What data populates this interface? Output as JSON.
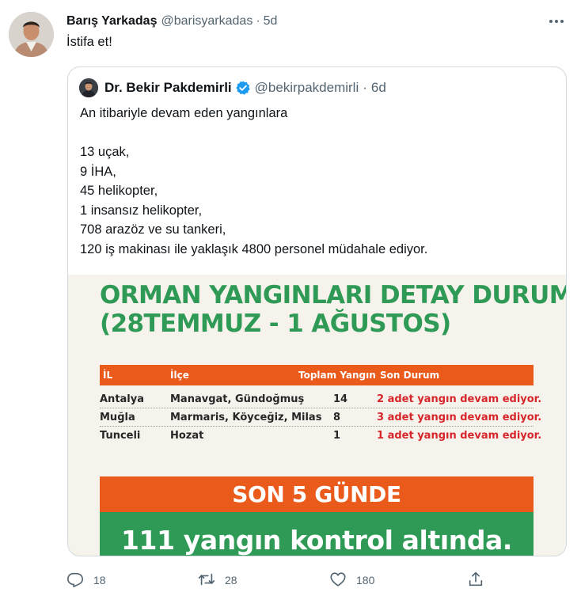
{
  "tweet": {
    "author_name": "Barış Yarkadaş",
    "author_handle": "@barisyarkadas",
    "separator": "·",
    "time": "5d",
    "text": "İstifa et!"
  },
  "quoted": {
    "author_name": "Dr. Bekir Pakdemirli",
    "author_handle": "@bekirpakdemirli",
    "separator": "·",
    "time": "6d",
    "lines": [
      "An itibariyle devam eden yangınlara",
      "",
      "13 uçak,",
      "9 İHA,",
      "45 helikopter,",
      "1 insansız helikopter,",
      "708 arazöz ve su tankeri,",
      "120 iş makinası ile yaklaşık 4800 personel müdahale ediyor."
    ],
    "image": {
      "title_line1": "ORMAN YANGINLARI DETAY DURUMU",
      "title_line2": "(28TEMMUZ - 1 AĞUSTOS)",
      "columns": [
        "İL",
        "İlçe",
        "Toplam Yangın",
        "Son Durum"
      ],
      "rows": [
        [
          "Antalya",
          "Manavgat, Gündoğmuş",
          "14",
          "2 adet yangın devam ediyor."
        ],
        [
          "Muğla",
          "Marmaris, Köyceğiz, Milas",
          "8",
          "3 adet yangın devam ediyor."
        ],
        [
          "Tunceli",
          "Hozat",
          "1",
          "1 adet yangın devam ediyor."
        ]
      ],
      "banner_top": "SON 5 GÜNDE",
      "banner_bottom": "111 yangın kontrol altında."
    }
  },
  "actions": {
    "replies": "18",
    "retweets": "28",
    "likes": "180"
  },
  "colors": {
    "text_primary": "#0f1419",
    "text_secondary": "#536471",
    "verified_blue": "#1d9bf0",
    "infographic_green": "#2e9a55",
    "infographic_orange": "#ea5a1b",
    "infographic_red": "#d7262b"
  },
  "icons": [
    "reply-icon",
    "retweet-icon",
    "like-icon",
    "share-icon",
    "more-icon",
    "verified-badge-icon"
  ]
}
